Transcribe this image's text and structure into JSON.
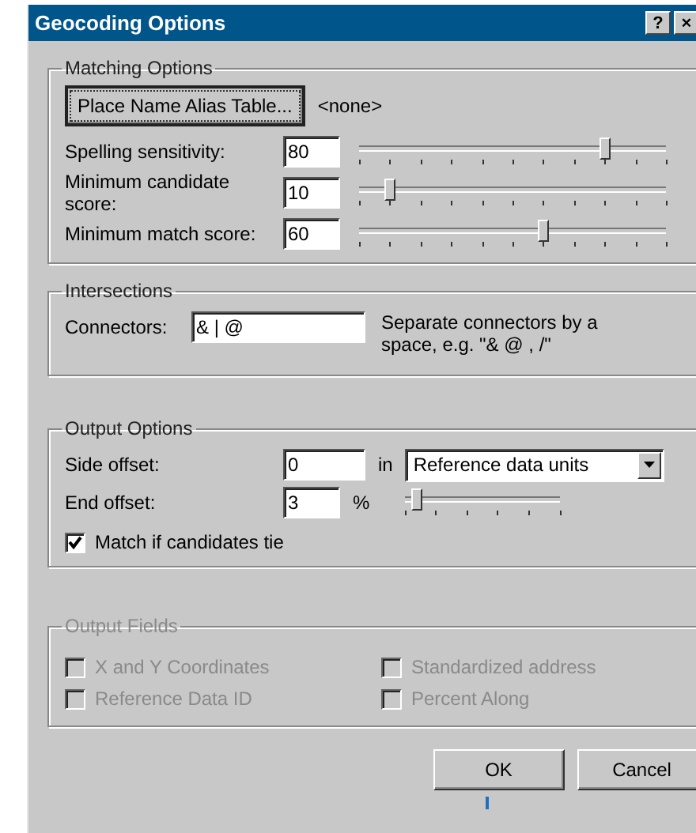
{
  "window": {
    "title": "Geocoding Options",
    "buttons": [
      "?",
      "×"
    ]
  },
  "matching_options": {
    "title": "Matching Options",
    "alias_button": "Place Name Alias Table...",
    "alias_value": "<none>",
    "rows": [
      {
        "label": "Spelling sensitivity:",
        "value": "80",
        "level": 0.8
      },
      {
        "label": "Minimum candidate score:",
        "value": "10",
        "level": 0.1
      },
      {
        "label": "Minimum match score:",
        "value": "60",
        "level": 0.6
      }
    ]
  },
  "intersections": {
    "title": "Intersections",
    "label": "Connectors:",
    "value": "& | @",
    "hint": "Separate connectors by a space, e.g. \"& @ , /\""
  },
  "output_options": {
    "title": "Output Options",
    "side_offset": {
      "label": "Side offset:",
      "value": "0",
      "unit_label": "in",
      "unit": "Reference data units"
    },
    "end_offset": {
      "label": "End offset:",
      "value": "3",
      "unit": "%",
      "level": 0.07
    },
    "match_if_tie": {
      "label": "Match if candidates tie",
      "checked": true
    }
  },
  "output_fields": {
    "title": "Output Fields",
    "disabled": true,
    "items": [
      {
        "label": "X and Y Coordinates",
        "checked": false
      },
      {
        "label": "Standardized address",
        "checked": false
      },
      {
        "label": "Reference Data ID",
        "checked": false
      },
      {
        "label": "Percent Along",
        "checked": false
      }
    ]
  },
  "buttons": [
    "OK",
    "Cancel"
  ]
}
